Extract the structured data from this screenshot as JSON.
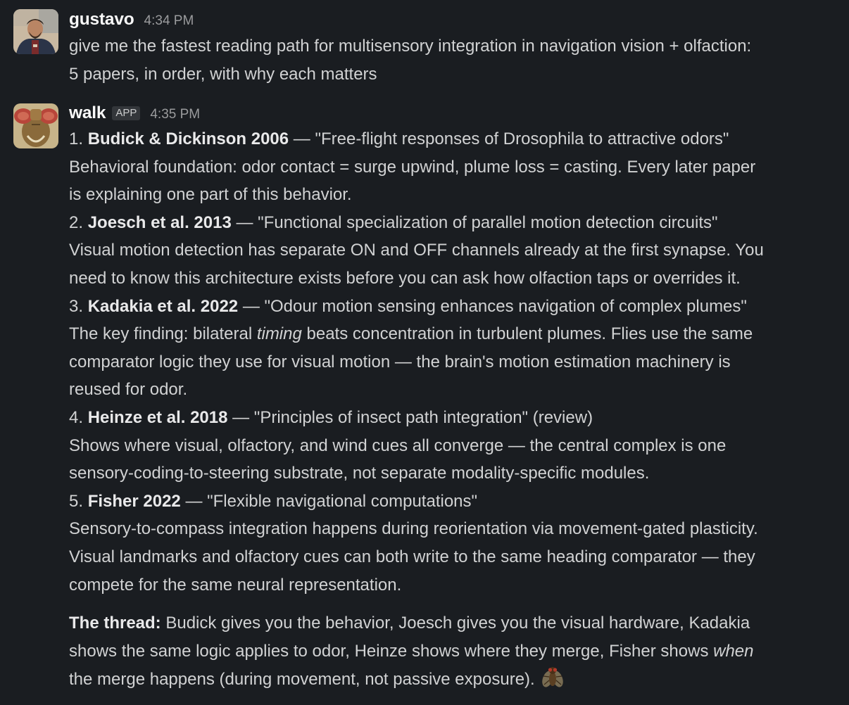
{
  "messages": [
    {
      "author": "gustavo",
      "timestamp": "4:34 PM",
      "lines": [
        "give me the fastest reading path for multisensory integration in navigation vision + olfaction:",
        "5 papers, in order, with why each matters"
      ]
    },
    {
      "author": "walk",
      "badge": "APP",
      "timestamp": "4:35 PM",
      "papers": [
        {
          "number": "1.",
          "citation": "Budick & Dickinson 2006",
          "title_rest": " — \"Free-flight responses of Drosophila to attractive odors\"",
          "lines": [
            "Behavioral foundation: odor contact = surge upwind, plume loss = casting. Every later paper",
            "is explaining one part of this behavior."
          ]
        },
        {
          "number": "2.",
          "citation": "Joesch et al. 2013",
          "title_rest": " — \"Functional specialization of parallel motion detection circuits\"",
          "lines": [
            "Visual motion detection has separate ON and OFF channels already at the first synapse. You",
            "need to know this architecture exists before you can ask how olfaction taps or overrides it."
          ]
        },
        {
          "number": "3.",
          "citation": "Kadakia et al. 2022",
          "title_rest": " — \"Odour motion sensing enhances navigation of complex plumes\"",
          "line1_pre": "The key finding: bilateral ",
          "line1_em": "timing",
          "line1_post": " beats concentration in turbulent plumes. Flies use the same",
          "lines": [
            "comparator logic they use for visual motion — the brain's motion estimation machinery is",
            "reused for odor."
          ]
        },
        {
          "number": "4.",
          "citation": "Heinze et al. 2018",
          "title_rest": " — \"Principles of insect path integration\" (review)",
          "lines": [
            "Shows where visual, olfactory, and wind cues all converge — the central complex is one",
            "sensory-coding-to-steering substrate, not separate modality-specific modules."
          ]
        },
        {
          "number": "5.",
          "citation": "Fisher 2022",
          "title_rest": " — \"Flexible navigational computations\"",
          "lines": [
            "Sensory-to-compass integration happens during reorientation via movement-gated plasticity.",
            "Visual landmarks and olfactory cues can both write to the same heading comparator — they",
            "compete for the same neural representation."
          ]
        }
      ],
      "summary": {
        "label": "The thread:",
        "line1": " Budick gives you the behavior, Joesch gives you the visual hardware, Kadakia",
        "line2_pre": "shows the same logic applies to odor, Heinze shows where they merge, Fisher shows ",
        "line2_em": "when",
        "line3": "the merge happens (during movement, not passive exposure).",
        "emoji": "fly-emoji"
      }
    }
  ]
}
